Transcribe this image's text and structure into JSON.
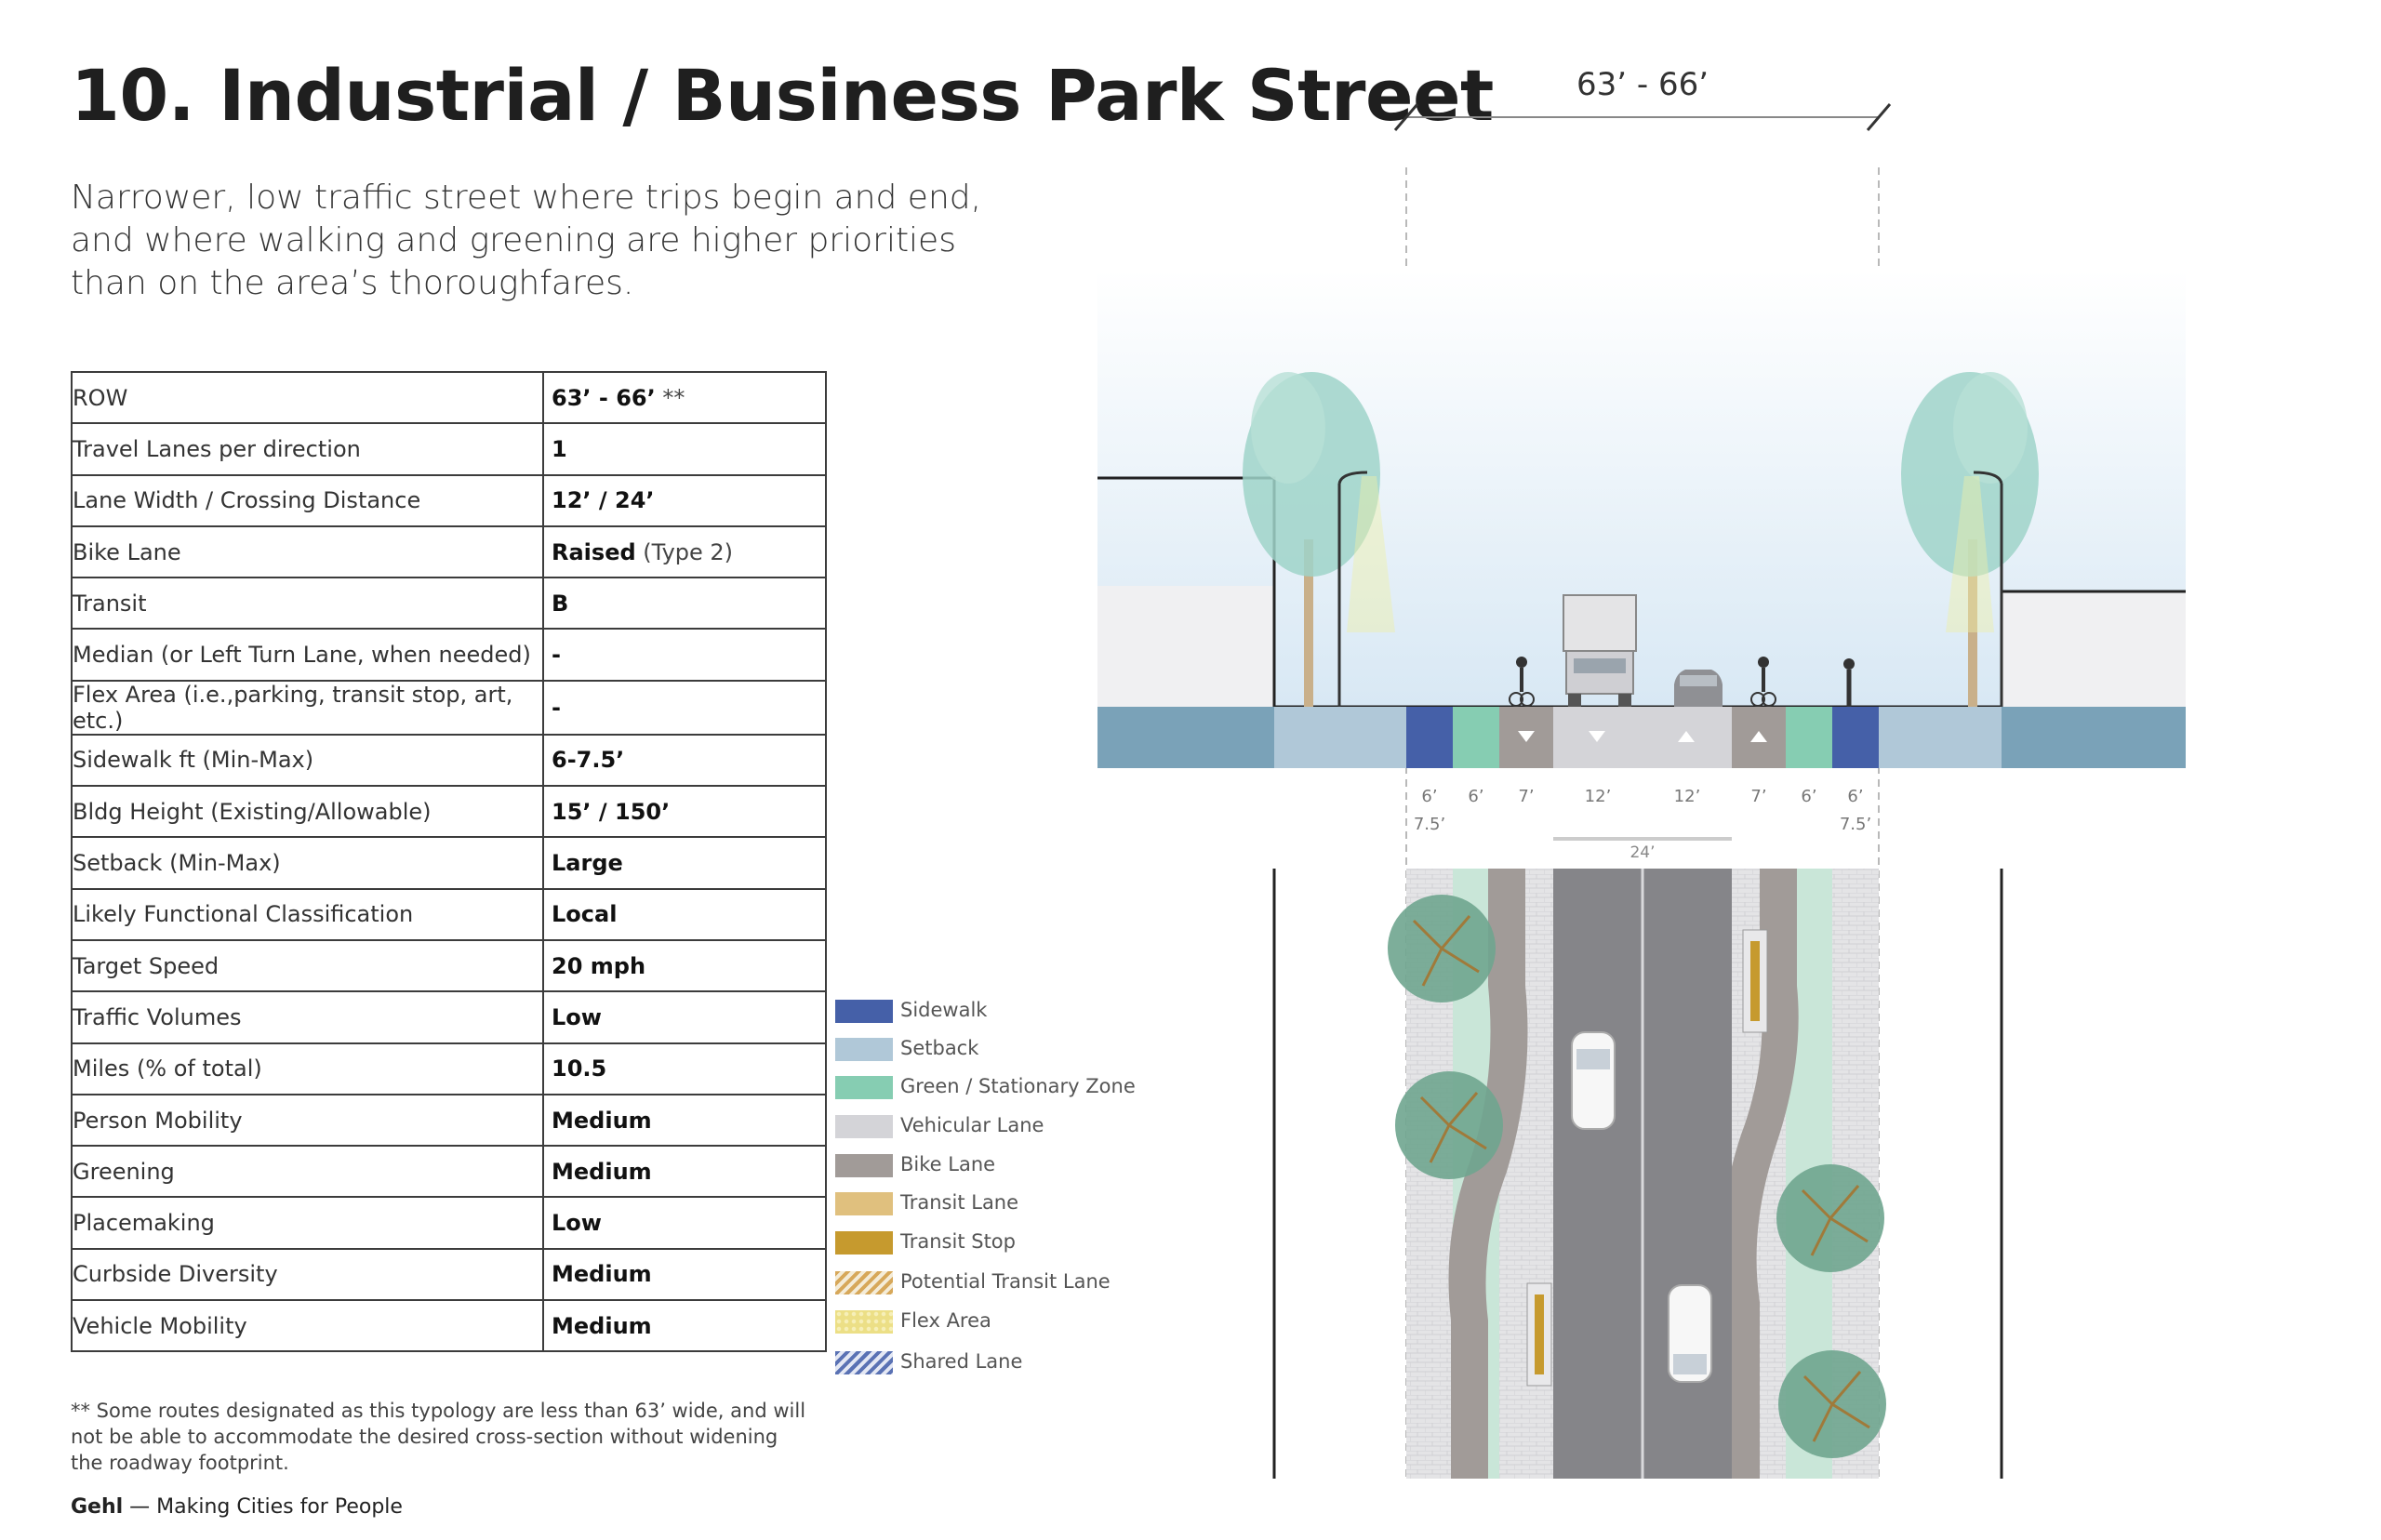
{
  "title": "10. Industrial / Business Park Street",
  "subtitle": "Narrower, low traffic street where trips begin and end, and where walking and greening are higher priorities than on the area’s thoroughfares.",
  "spec_rows": [
    {
      "label": "ROW",
      "value": "63’ - 66’",
      "note": " **"
    },
    {
      "label": "Travel Lanes per direction",
      "value": "1",
      "note": ""
    },
    {
      "label": "Lane Width / Crossing Distance",
      "value": "12’ / 24’",
      "note": ""
    },
    {
      "label": "Bike Lane",
      "value": "Raised",
      "note": " (Type 2)"
    },
    {
      "label": "Transit",
      "value": "B",
      "note": ""
    },
    {
      "label": "Median (or Left Turn Lane, when needed)",
      "value": "-",
      "note": ""
    },
    {
      "label": "Flex Area (i.e.,parking, transit stop, art, etc.)",
      "value": "-",
      "note": ""
    },
    {
      "label": "Sidewalk ft (Min-Max)",
      "value": "6-7.5’",
      "note": ""
    },
    {
      "label": "Bldg Height (Existing/Allowable)",
      "value": "15’ / 150’",
      "note": ""
    },
    {
      "label": "Setback (Min-Max)",
      "value": "Large",
      "note": ""
    },
    {
      "label": "Likely Functional Classification",
      "value": "Local",
      "note": ""
    },
    {
      "label": "Target Speed",
      "value": "20 mph",
      "note": ""
    },
    {
      "label": "Traffic Volumes",
      "value": "Low",
      "note": ""
    },
    {
      "label": "Miles (% of total)",
      "value": "10.5",
      "note": ""
    },
    {
      "label": "Person Mobility",
      "value": "Medium",
      "note": ""
    },
    {
      "label": "Greening",
      "value": "Medium",
      "note": ""
    },
    {
      "label": "Placemaking",
      "value": "Low",
      "note": ""
    },
    {
      "label": "Curbside Diversity",
      "value": "Medium",
      "note": ""
    },
    {
      "label": "Vehicle Mobility",
      "value": "Medium",
      "note": ""
    }
  ],
  "footnote": "** Some routes designated as this typology are less than 63’ wide, and will not be able to accommodate the desired cross-section without widening the roadway footprint.",
  "credit": {
    "brand": "Gehl",
    "tagline": " — Making Cities for People"
  },
  "legend": [
    {
      "label": "Sidewalk",
      "color": "#4560a8",
      "pattern": "solid"
    },
    {
      "label": "Setback",
      "color": "#b0c8d8",
      "pattern": "solid"
    },
    {
      "label": "Green / Stationary Zone",
      "color": "#86cdb2",
      "pattern": "solid"
    },
    {
      "label": "Vehicular Lane",
      "color": "#d4d4d8",
      "pattern": "solid"
    },
    {
      "label": "Bike Lane",
      "color": "#a19b98",
      "pattern": "solid"
    },
    {
      "label": "Transit Lane",
      "color": "#e0c07e",
      "pattern": "solid"
    },
    {
      "label": "Transit Stop",
      "color": "#c69a2e",
      "pattern": "solid"
    },
    {
      "label": "Potential Transit Lane",
      "color": "#d7a85a",
      "pattern": "hatch"
    },
    {
      "label": "Flex Area",
      "color": "#ecdf86",
      "pattern": "dots"
    },
    {
      "label": "Shared Lane",
      "color": "#5a72b4",
      "pattern": "hatch"
    }
  ],
  "diagram": {
    "total_width": "63’ - 66’",
    "crossing": "24’",
    "segments": [
      {
        "top": "6’",
        "bottom": "7.5’"
      },
      {
        "top": "6’",
        "bottom": ""
      },
      {
        "top": "7’",
        "bottom": ""
      },
      {
        "top": "12’",
        "bottom": ""
      },
      {
        "top": "12’",
        "bottom": ""
      },
      {
        "top": "7’",
        "bottom": ""
      },
      {
        "top": "6’",
        "bottom": ""
      },
      {
        "top": "6’",
        "bottom": "7.5’"
      }
    ]
  }
}
